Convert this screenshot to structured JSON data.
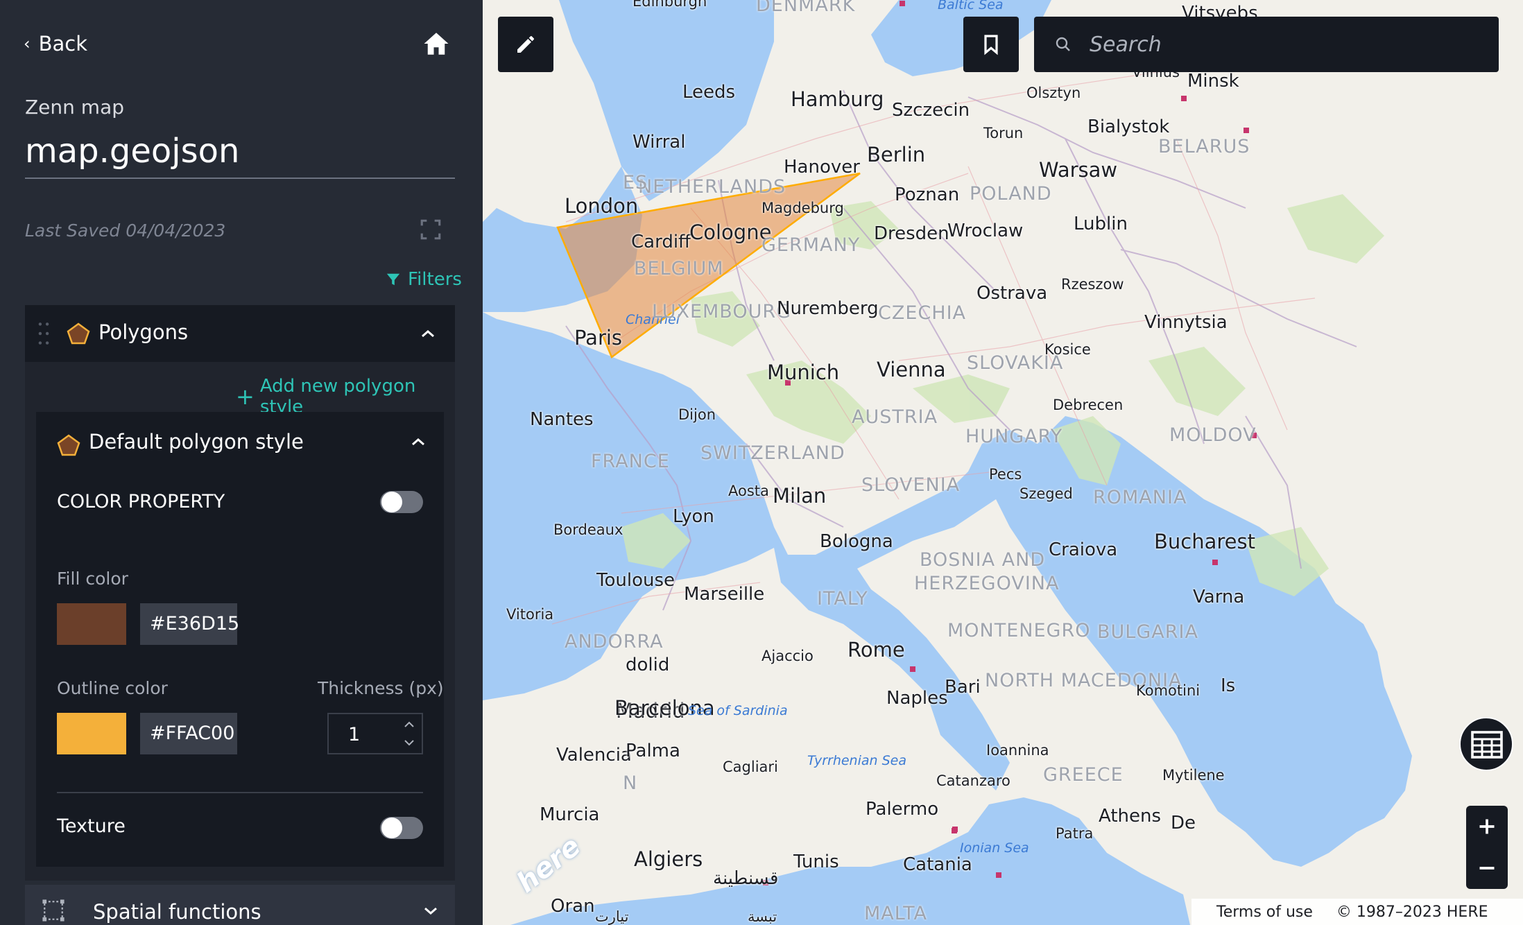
{
  "sidebar": {
    "back_label": "Back",
    "subtitle": "Zenn map",
    "filename": "map.geojson",
    "last_saved": "Last Saved 04/04/2023",
    "filters_label": "Filters",
    "polygons_label": "Polygons",
    "add_style_label": "Add new polygon style",
    "style": {
      "title": "Default polygon style",
      "color_property_label": "COLOR PROPERTY",
      "color_property_on": false,
      "fill_color_label": "Fill color",
      "fill_color_hex": "#E36D15",
      "fill_swatch_color": "#6b3f2a",
      "outline_color_label": "Outline color",
      "outline_color_hex": "#FFAC00",
      "outline_swatch_color": "#f4b03a",
      "thickness_label": "Thickness (px)",
      "thickness_value": "1",
      "texture_label": "Texture",
      "texture_on": false
    },
    "spatial_label": "Spatial functions"
  },
  "map": {
    "search_placeholder": "Search",
    "attribution_terms": "Terms of use",
    "attribution_copyright": "© 1987–2023 HERE",
    "logo_text": "here",
    "polygon_fill": "#e3893f",
    "polygon_outline": "#ffac00",
    "labels": {
      "edinburgh": "Edinburgh",
      "denmark": "DENMARK",
      "baltic": "Baltic Sea",
      "vitsyebsk": "Vitsyebs",
      "vilnius": "Vilnius",
      "minsk": "Minsk",
      "leeds": "Leeds",
      "hamburg": "Hamburg",
      "szczecin": "Szczecin",
      "olsztyn": "Olsztyn",
      "bialystok": "Bialystok",
      "belarus": "BELARUS",
      "wirral": "Wirral",
      "torun": "Torun",
      "hanover": "Hanover",
      "berlin": "Berlin",
      "warsaw": "Warsaw",
      "netherlands": "NETHERLANDS",
      "es": "ES",
      "london": "London",
      "magdeburg": "Magdeburg",
      "poznan": "Poznan",
      "poland": "POLAND",
      "cardiff": "Cardiff",
      "cologne": "Cologne",
      "germany": "GERMANY",
      "dresden": "Dresden",
      "wroclaw": "Wroclaw",
      "lublin": "Lublin",
      "belgium": "BELGIUM",
      "ostrava": "Ostrava",
      "rzeszow": "Rzeszow",
      "channel": "Channel",
      "luxembourg": "LUXEMBOURG",
      "nuremberg": "Nuremberg",
      "czechia": "CZECHIA",
      "paris": "Paris",
      "vinnytsia": "Vinnytsia",
      "kosice": "Kosice",
      "munich": "Munich",
      "vienna": "Vienna",
      "slovakia": "SLOVAKIA",
      "debrecen": "Debrecen",
      "nantes": "Nantes",
      "dijon": "Dijon",
      "austria": "AUSTRIA",
      "hungary": "HUNGARY",
      "moldova": "MOLDOV",
      "france": "FRANCE",
      "switzerland": "SWITZERLAND",
      "pecs": "Pecs",
      "aosta": "Aosta",
      "milan": "Milan",
      "slovenia": "SLOVENIA",
      "szeged": "Szeged",
      "romania": "ROMANIA",
      "bordeaux": "Bordeaux",
      "lyon": "Lyon",
      "bologna": "Bologna",
      "bucharest": "Bucharest",
      "craiova": "Craiova",
      "bosnia1": "BOSNIA AND",
      "bosnia2": "HERZEGOVINA",
      "toulouse": "Toulouse",
      "marseille": "Marseille",
      "varna": "Varna",
      "vitoria": "Vitoria",
      "italy": "ITALY",
      "andorra": "ANDORRA",
      "montenegro": "MONTENEGRO",
      "bulgaria": "BULGARIA",
      "ajaccio": "Ajaccio",
      "rome": "Rome",
      "dolid": "dolid",
      "macedonia": "NORTH MACEDONIA",
      "komotini": "Komotini",
      "bari": "Bari",
      "naples": "Naples",
      "madrid": "Madrid",
      "barcelona": "Barcelona",
      "sardinia": "Sea of Sardinia",
      "ioannina": "Ioannina",
      "valencia": "Valencia",
      "palma": "Palma",
      "cagliari": "Cagliari",
      "tyrrhenian": "Tyrrhenian Sea",
      "greece": "GREECE",
      "mytilene": "Mytilene",
      "catanzaro": "Catanzaro",
      "murcia": "Murcia",
      "palermo": "Palermo",
      "athens": "Athens",
      "patra": "Patra",
      "de": "De",
      "ionian": "Ionian Sea",
      "algiers": "Algiers",
      "tunis": "Tunis",
      "catania": "Catania",
      "constantine": "قسنطينة",
      "oran": "Oran",
      "tiaret": "تيارت",
      "tebessa": "تبسة",
      "malta": "MALTA",
      "n": "N",
      "is": "Is"
    }
  }
}
